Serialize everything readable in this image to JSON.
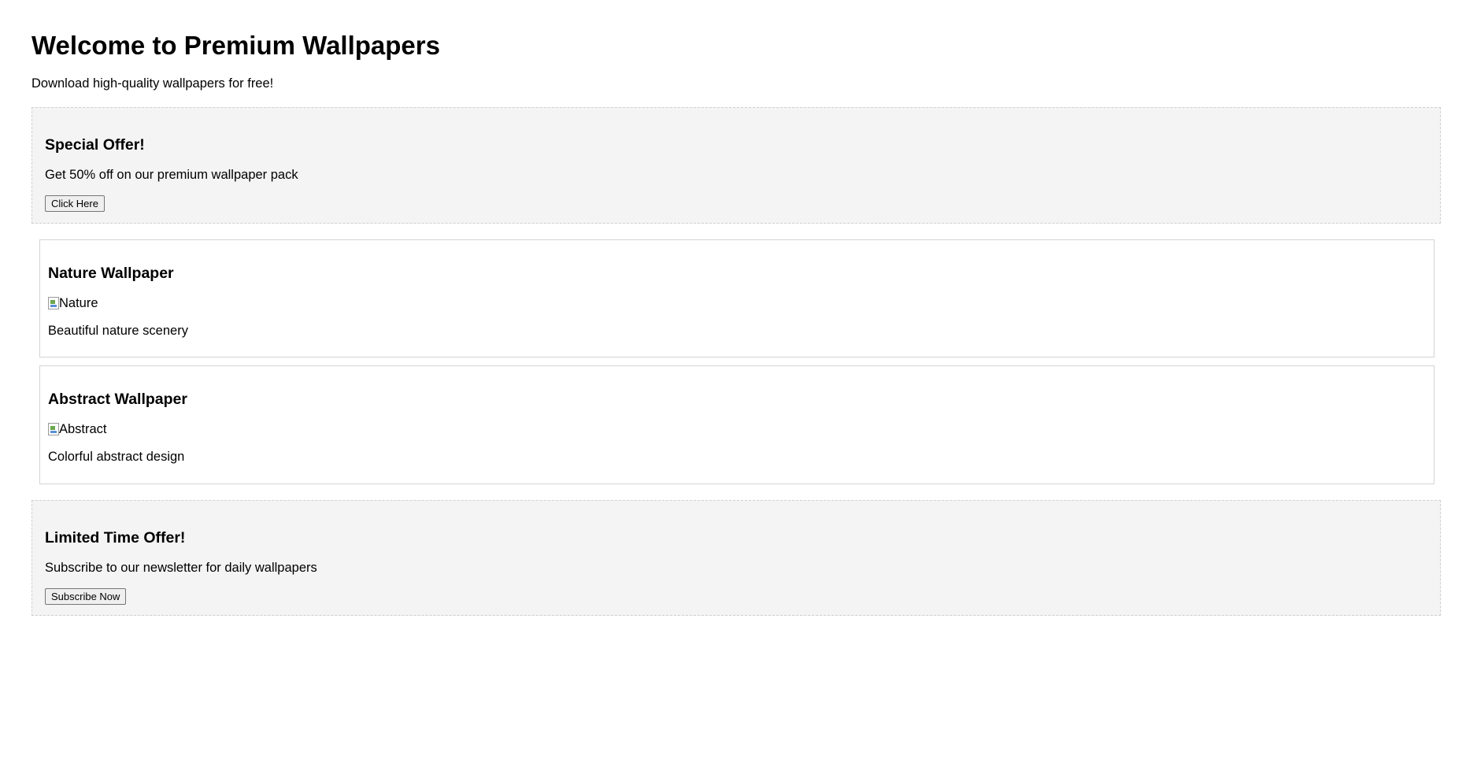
{
  "header": {
    "title": "Welcome to Premium Wallpapers",
    "subtitle": "Download high-quality wallpapers for free!"
  },
  "offers": [
    {
      "heading": "Special Offer!",
      "text": "Get 50% off on our premium wallpaper pack",
      "button_label": "Click Here"
    },
    {
      "heading": "Limited Time Offer!",
      "text": "Subscribe to our newsletter for daily wallpapers",
      "button_label": "Subscribe Now"
    }
  ],
  "wallpapers": [
    {
      "heading": "Nature Wallpaper",
      "image_alt": "Nature",
      "description": "Beautiful nature scenery"
    },
    {
      "heading": "Abstract Wallpaper",
      "image_alt": "Abstract",
      "description": "Colorful abstract design"
    }
  ],
  "colors": {
    "offer_background": "#f4f4f4",
    "offer_border": "#cfcfcf",
    "card_border": "#d4d4d4"
  },
  "icons": {
    "broken_image": "broken-image-icon"
  }
}
